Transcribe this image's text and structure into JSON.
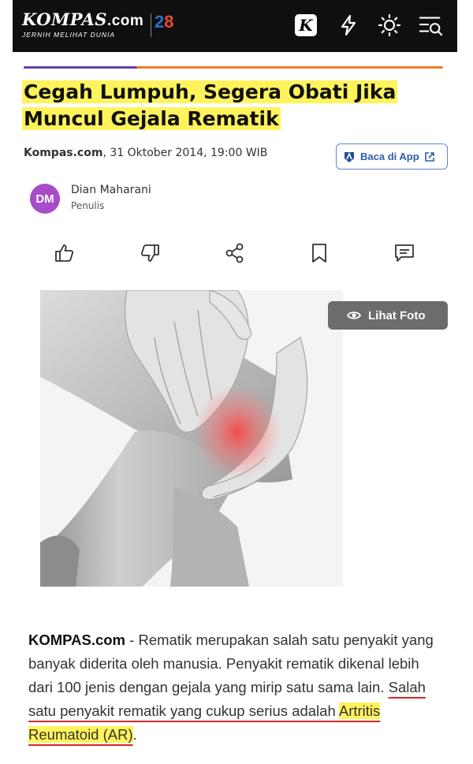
{
  "header": {
    "logo_text": "KOMPAS",
    "logo_suffix": ".com",
    "logo_tagline": "JERNIH MELIHAT DUNIA",
    "anniversary_prefix": "2",
    "anniversary_suffix": "8",
    "icons": [
      "k-icon",
      "lightning-icon",
      "sun-icon",
      "menu-search-icon"
    ]
  },
  "article": {
    "title": "Cegah Lumpuh, Segera Obati Jika Muncul Gejala Rematik",
    "source": "Kompas.com",
    "date": ", 31 Oktober 2014, 19:00 WIB",
    "app_button": "Baca di App",
    "author": {
      "initials": "DM",
      "name": "Dian Maharani",
      "role": "Penulis"
    },
    "actions": [
      "like-icon",
      "dislike-icon",
      "share-icon",
      "bookmark-icon",
      "comment-icon"
    ],
    "photo_button": "Lihat Foto",
    "body": {
      "source": "KOMPAS.com",
      "dash": " - ",
      "text1": "Rematik merupakan salah satu penyakit yang banyak diderita oleh manusia. Penyakit rematik dikenal lebih dari 100 jenis dengan gejala yang mirip satu sama lain. ",
      "underlined": "Salah satu penyakit rematik yang cukup serius adalah ",
      "highlighted": "Artritis Reumatoid (AR)",
      "end": "."
    }
  },
  "colors": {
    "header_bg": "#0f0f0f",
    "highlight": "#fff35c",
    "accent_purple": "#6a3faa",
    "accent_orange": "#f07d2a",
    "avatar": "#a84cc9",
    "app_button": "#2e5ea8",
    "underline": "#d62828"
  }
}
